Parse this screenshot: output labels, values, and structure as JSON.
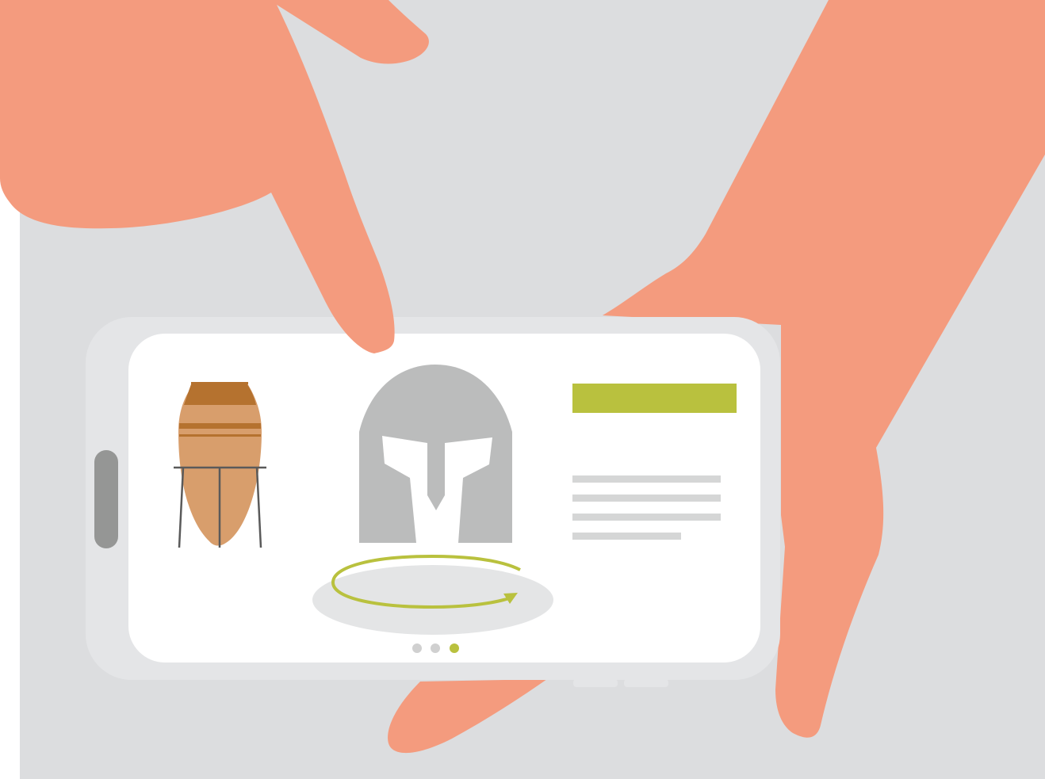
{
  "scene": {
    "background_color": "#dcdddf",
    "skin_color": "#f49b7e",
    "phone_frame_color": "#e4e5e7",
    "phone_screen_color": "#ffffff",
    "phone_side_button_color": "#959695"
  },
  "screen": {
    "artifacts": [
      {
        "icon": "amphora-on-stand-icon",
        "colors": [
          "#d89e6c",
          "#b5722f",
          "#5a5a5a"
        ]
      },
      {
        "icon": "greek-helmet-icon",
        "colors": [
          "#bbbcbc"
        ]
      }
    ],
    "rotate_control": {
      "icon": "rotate-360-icon",
      "color": "#b9c13e",
      "platform_color": "#e4e5e6"
    },
    "info_panel": {
      "title_bar_color": "#b9c13e",
      "text_line_color": "#d5d6d6",
      "text_line_count": 4
    },
    "pagination": {
      "total": 3,
      "active_index": 2,
      "active_color": "#b9c13e",
      "inactive_color": "#d0d0d0"
    }
  }
}
